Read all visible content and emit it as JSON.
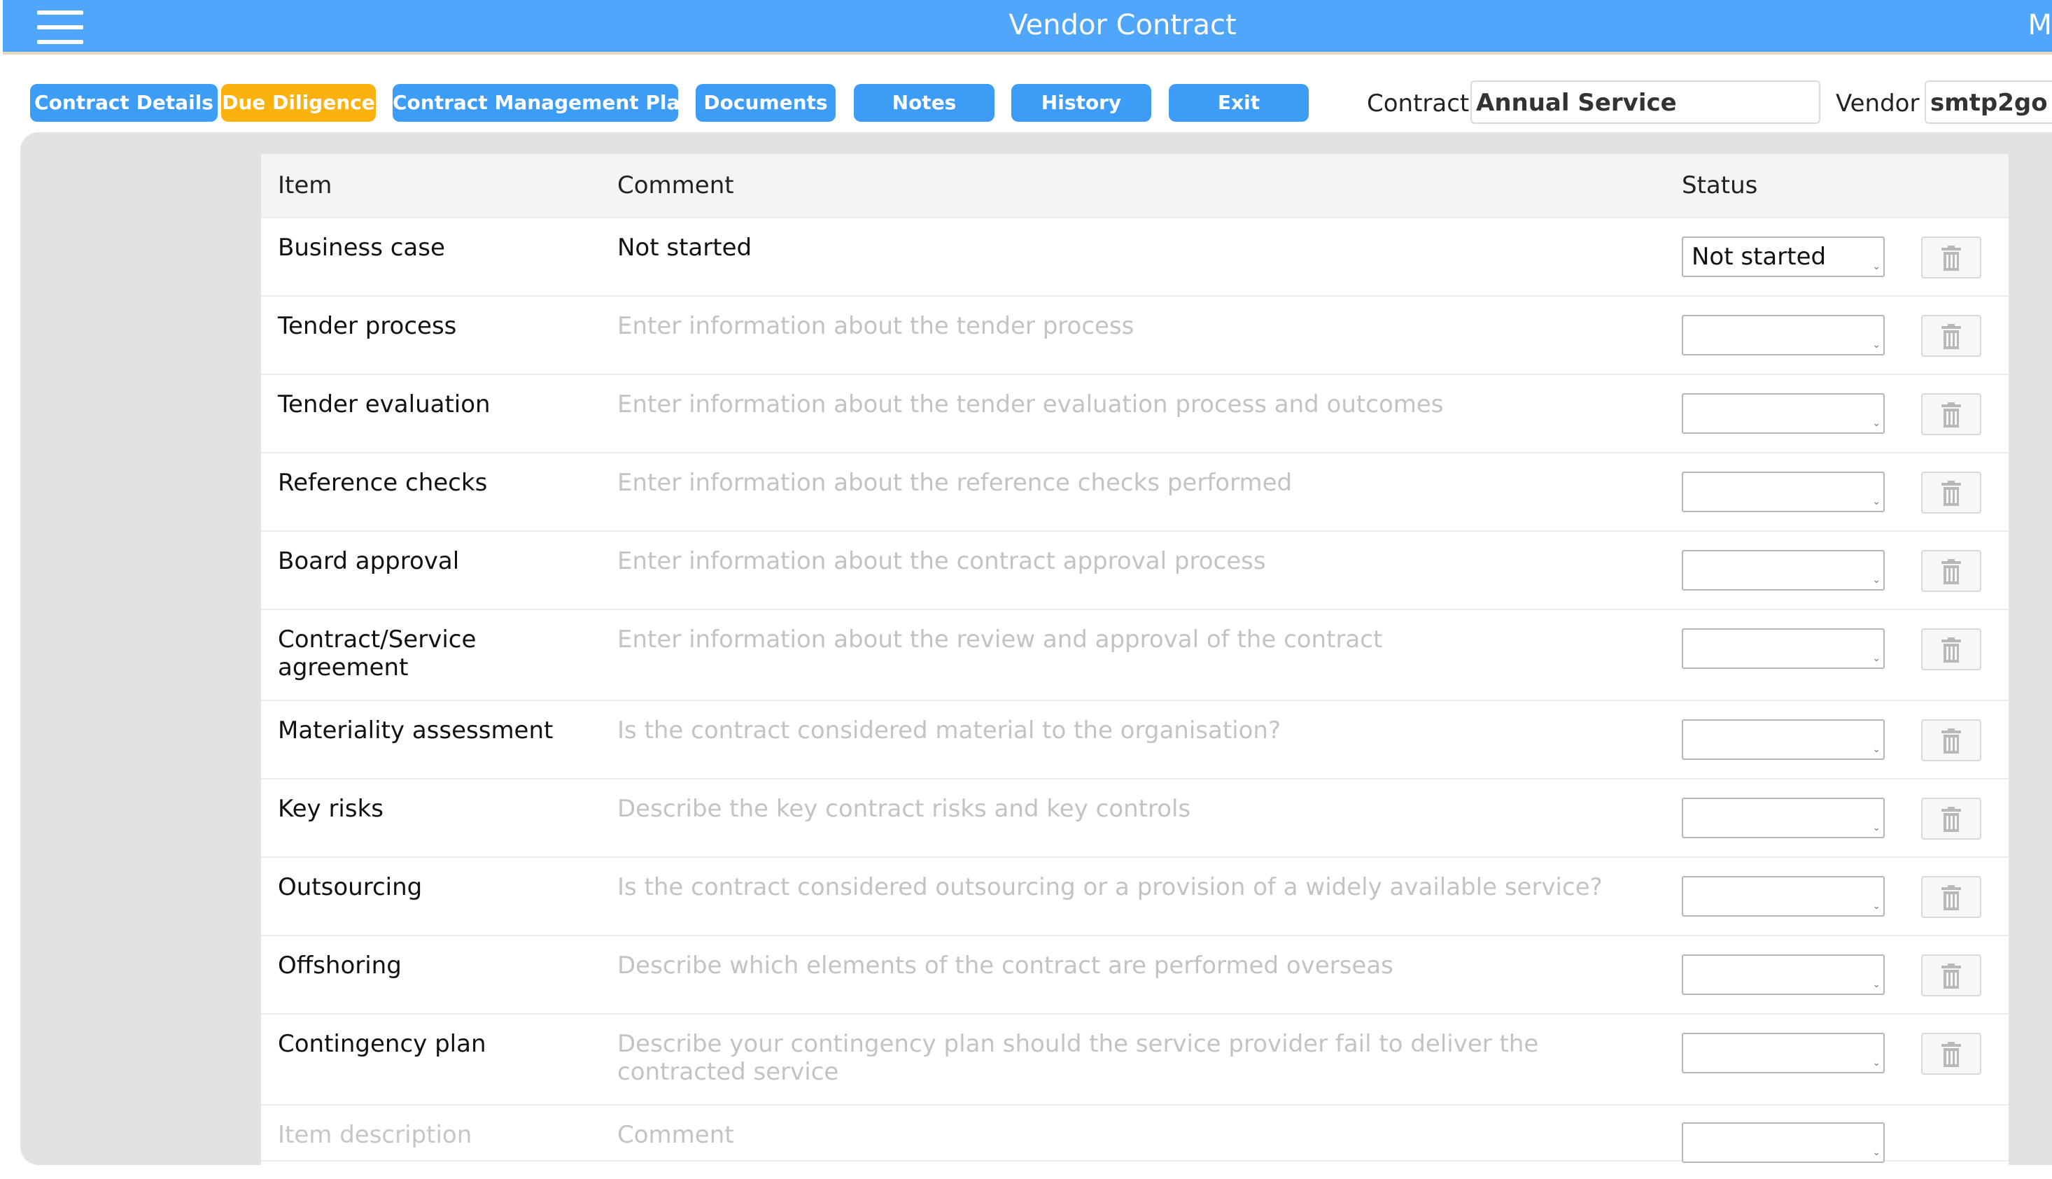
{
  "window": {
    "title": "Vendor Contract",
    "edge_glyph": "M"
  },
  "toolbar": {
    "buttons": [
      {
        "label": "Contract Details",
        "active": false
      },
      {
        "label": "Due Diligence",
        "active": true
      },
      {
        "label": "Contract Management Plan",
        "active": false
      },
      {
        "label": "Documents",
        "active": false
      },
      {
        "label": "Notes",
        "active": false
      },
      {
        "label": "History",
        "active": false
      },
      {
        "label": "Exit",
        "active": false
      }
    ],
    "contract_label": "Contract",
    "contract_value": "Annual Service",
    "vendor_label": "Vendor",
    "vendor_value": "smtp2go"
  },
  "table": {
    "headers": {
      "item": "Item",
      "comment": "Comment",
      "status": "Status"
    },
    "rows": [
      {
        "item": "Business case",
        "comment": "Not started",
        "comment_is_placeholder": false,
        "status": "Not started"
      },
      {
        "item": "Tender process",
        "comment": "Enter information about the tender process",
        "comment_is_placeholder": true,
        "status": ""
      },
      {
        "item": "Tender evaluation",
        "comment": "Enter information about the tender evaluation process and outcomes",
        "comment_is_placeholder": true,
        "status": ""
      },
      {
        "item": "Reference checks",
        "comment": "Enter information about the reference checks performed",
        "comment_is_placeholder": true,
        "status": ""
      },
      {
        "item": "Board approval",
        "comment": "Enter information about the contract approval process",
        "comment_is_placeholder": true,
        "status": ""
      },
      {
        "item": "Contract/Service agreement",
        "comment": "Enter information about the review and approval of the contract",
        "comment_is_placeholder": true,
        "status": ""
      },
      {
        "item": "Materiality assessment",
        "comment": "Is the contract considered material to the organisation?",
        "comment_is_placeholder": true,
        "status": ""
      },
      {
        "item": "Key risks",
        "comment": "Describe the key contract risks and key controls",
        "comment_is_placeholder": true,
        "status": ""
      },
      {
        "item": "Outsourcing",
        "comment": "Is the contract considered outsourcing or a provision of a widely available service?",
        "comment_is_placeholder": true,
        "status": ""
      },
      {
        "item": "Offshoring",
        "comment": "Describe which elements of the contract are performed overseas",
        "comment_is_placeholder": true,
        "status": ""
      },
      {
        "item": "Contingency plan",
        "comment": "Describe your contingency plan should the service provider fail to deliver the contracted service",
        "comment_is_placeholder": true,
        "status": ""
      }
    ],
    "new_row": {
      "item_placeholder": "Item description",
      "comment_placeholder": "Comment",
      "status": ""
    }
  },
  "icons": {
    "menu": "hamburger-menu-icon",
    "delete": "trash-icon",
    "dropdown": "chevron-down-icon"
  },
  "colors": {
    "titlebar": "#4fa6fb",
    "button": "#3d9cf6",
    "button_active": "#fbb20f",
    "panel": "#e2e2e2"
  }
}
